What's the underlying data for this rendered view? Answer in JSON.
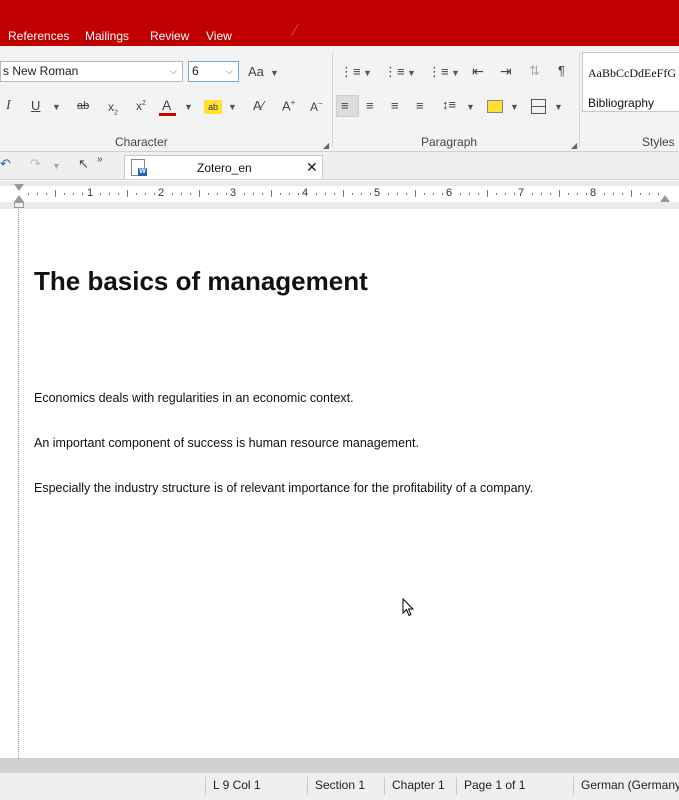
{
  "menubar": {
    "items": [
      "References",
      "Mailings",
      "Review",
      "View"
    ]
  },
  "ribbon": {
    "font_name": "s New Roman",
    "font_size": "6",
    "groups": {
      "character": "Character",
      "paragraph": "Paragraph",
      "styles": "Styles"
    },
    "styles": {
      "sample": "AaBbCcDdEeFfG",
      "current": "Bibliography"
    }
  },
  "document_tab": {
    "title": "Zotero_en"
  },
  "ruler": {
    "numbers": [
      "1",
      "2",
      "3",
      "4",
      "5",
      "6",
      "7",
      "8"
    ]
  },
  "document": {
    "heading": "The basics of management",
    "paragraphs": [
      "Economics deals with regularities in an economic context.",
      "An important component of success is human resource management.",
      "Especially the industry structure is of relevant importance for the profitability of a company."
    ]
  },
  "statusbar": {
    "position": "L 9 Col 1",
    "section": "Section 1",
    "chapter": "Chapter 1",
    "page": "Page 1 of 1",
    "language": "German (Germany)"
  },
  "colors": {
    "accent": "#c00000"
  }
}
